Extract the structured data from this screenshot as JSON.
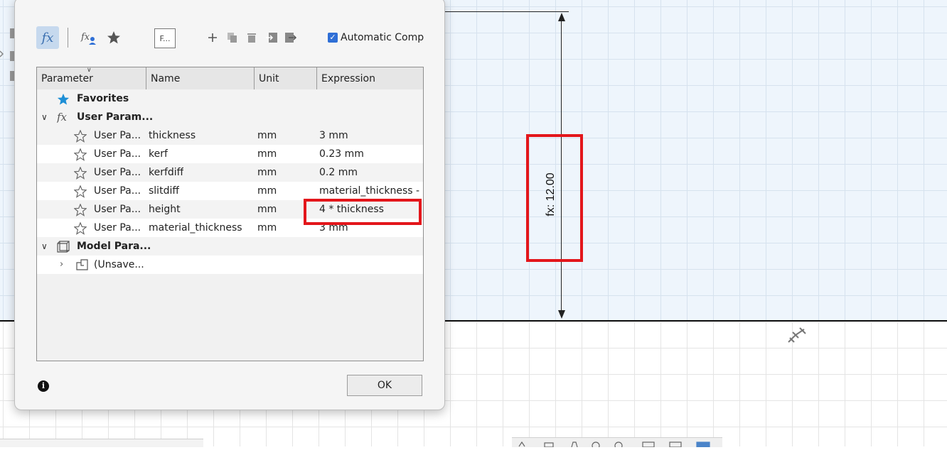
{
  "toolbar": {
    "filter_placeholder": "F...",
    "auto_compute_label": "Automatic Comp"
  },
  "table": {
    "headers": [
      "Parameter",
      "Name",
      "Unit",
      "Expression"
    ],
    "favorites_label": "Favorites",
    "user_group_label": "User Param...",
    "user_rows": [
      {
        "parameter": "User Pa...",
        "name": "thickness",
        "unit": "mm",
        "expression": "3 mm"
      },
      {
        "parameter": "User Pa...",
        "name": "kerf",
        "unit": "mm",
        "expression": "0.23 mm"
      },
      {
        "parameter": "User Pa...",
        "name": "kerfdiff",
        "unit": "mm",
        "expression": "0.2 mm"
      },
      {
        "parameter": "User Pa...",
        "name": "slitdiff",
        "unit": "mm",
        "expression": "material_thickness -"
      },
      {
        "parameter": "User Pa...",
        "name": "height",
        "unit": "mm",
        "expression": "4 * thickness"
      },
      {
        "parameter": "User Pa...",
        "name": "material_thickness",
        "unit": "mm",
        "expression": "3 mm"
      }
    ],
    "model_group_label": "Model Para...",
    "model_child_label": "(Unsave..."
  },
  "footer": {
    "ok_label": "OK"
  },
  "canvas": {
    "dimension_label": "fx: 12.00"
  },
  "colors": {
    "highlight": "#e3161b",
    "accent": "#2f6fd6",
    "favorites_star": "#1e8fd6"
  }
}
